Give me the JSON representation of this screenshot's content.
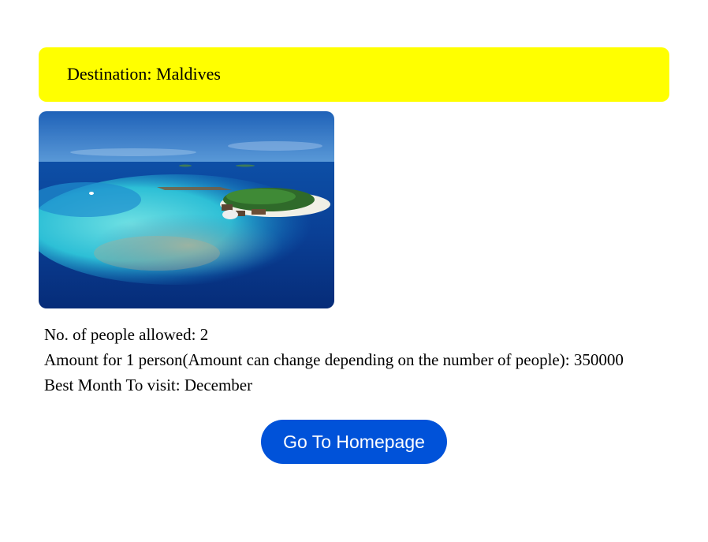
{
  "destination": {
    "label": "Destination: Maldives"
  },
  "photo": {
    "subject": "maldives-island-aerial"
  },
  "info": {
    "people_allowed": "No. of people allowed: 2",
    "amount": "Amount for 1 person(Amount can change depending on the number of people): 350000",
    "best_month": "Best Month To visit: December"
  },
  "actions": {
    "home_label": "Go To Homepage"
  },
  "colors": {
    "banner_bg": "#ffff00",
    "button_bg": "#0052d9",
    "button_text": "#ffffff"
  }
}
